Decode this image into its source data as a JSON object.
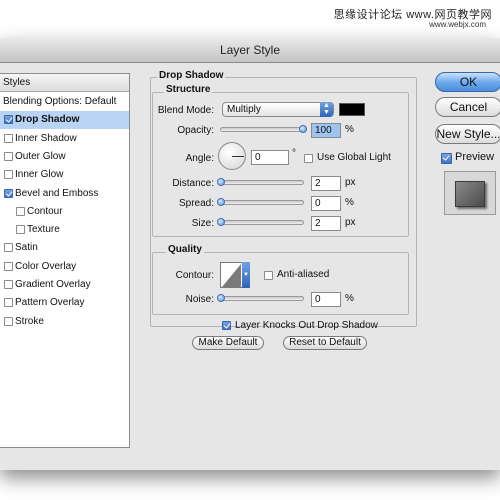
{
  "watermark": {
    "line1": "思缘设计论坛 www.网页教学网",
    "line2": "www.webjx.com"
  },
  "dialog": {
    "title": "Layer Style"
  },
  "styles_list": {
    "header": "Styles",
    "items": [
      {
        "label": "Blending Options: Default",
        "checkbox": false,
        "checked": false,
        "selected": false,
        "indent": false
      },
      {
        "label": "Drop Shadow",
        "checkbox": true,
        "checked": true,
        "selected": true,
        "indent": false
      },
      {
        "label": "Inner Shadow",
        "checkbox": true,
        "checked": false,
        "selected": false,
        "indent": false
      },
      {
        "label": "Outer Glow",
        "checkbox": true,
        "checked": false,
        "selected": false,
        "indent": false
      },
      {
        "label": "Inner Glow",
        "checkbox": true,
        "checked": false,
        "selected": false,
        "indent": false
      },
      {
        "label": "Bevel and Emboss",
        "checkbox": true,
        "checked": true,
        "selected": false,
        "indent": false
      },
      {
        "label": "Contour",
        "checkbox": true,
        "checked": false,
        "selected": false,
        "indent": true
      },
      {
        "label": "Texture",
        "checkbox": true,
        "checked": false,
        "selected": false,
        "indent": true
      },
      {
        "label": "Satin",
        "checkbox": true,
        "checked": false,
        "selected": false,
        "indent": false
      },
      {
        "label": "Color Overlay",
        "checkbox": true,
        "checked": false,
        "selected": false,
        "indent": false
      },
      {
        "label": "Gradient Overlay",
        "checkbox": true,
        "checked": false,
        "selected": false,
        "indent": false
      },
      {
        "label": "Pattern Overlay",
        "checkbox": true,
        "checked": false,
        "selected": false,
        "indent": false
      },
      {
        "label": "Stroke",
        "checkbox": true,
        "checked": false,
        "selected": false,
        "indent": false
      }
    ]
  },
  "drop_shadow": {
    "title": "Drop Shadow",
    "structure": {
      "title": "Structure",
      "blend_mode_label": "Blend Mode:",
      "blend_mode_value": "Multiply",
      "shadow_color": "#000000",
      "opacity_label": "Opacity:",
      "opacity_value": "100",
      "opacity_level": 1.0,
      "percent": "%",
      "angle_label": "Angle:",
      "angle_value": "0",
      "degree": "°",
      "global_light_label": "Use Global Light",
      "global_light_checked": false,
      "distance_label": "Distance:",
      "distance_value": "2",
      "distance_level": 0.0,
      "px": "px",
      "spread_label": "Spread:",
      "spread_value": "0",
      "spread_level": 0.0,
      "size_label": "Size:",
      "size_value": "2",
      "size_level": 0.0
    },
    "quality": {
      "title": "Quality",
      "contour_label": "Contour:",
      "anti_aliased_label": "Anti-aliased",
      "anti_aliased_checked": false,
      "noise_label": "Noise:",
      "noise_value": "0",
      "noise_level": 0.0
    },
    "knockout_label": "Layer Knocks Out Drop Shadow",
    "knockout_checked": true,
    "make_default": "Make Default",
    "reset_default": "Reset to Default"
  },
  "buttons": {
    "ok": "OK",
    "cancel": "Cancel",
    "new_style": "New Style...",
    "preview": "Preview",
    "preview_checked": true
  }
}
